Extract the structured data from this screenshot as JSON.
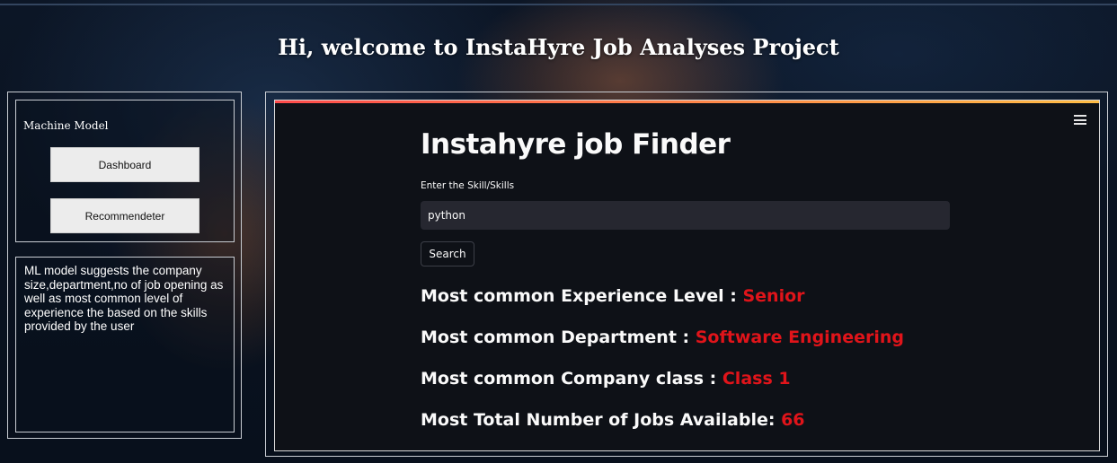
{
  "header": {
    "welcome": "Hi, welcome to InstaHyre Job Analyses Project"
  },
  "sidebar": {
    "section_title": "Machine Model",
    "buttons": [
      {
        "label": "Dashboard"
      },
      {
        "label": "Recommendeter"
      }
    ],
    "description": "ML model suggests the company size,department,no of job opening as well as most common level of experience the based on the skills provided by the user"
  },
  "main": {
    "title": "Instahyre job Finder",
    "input_label": "Enter the Skill/Skills",
    "input_value": "python",
    "search_label": "Search",
    "results": [
      {
        "label": "Most common Experience Level : ",
        "value": "Senior"
      },
      {
        "label": "Most common Department : ",
        "value": "Software Engineering"
      },
      {
        "label": "Most common Company class : ",
        "value": "Class 1"
      },
      {
        "label": "Most Total Number of Jobs Available: ",
        "value": "66"
      }
    ]
  },
  "colors": {
    "accent": "#e0141a",
    "panel_bg": "#0e1117",
    "input_bg": "#262730"
  },
  "icons": {
    "menu": "hamburger-menu-icon"
  }
}
